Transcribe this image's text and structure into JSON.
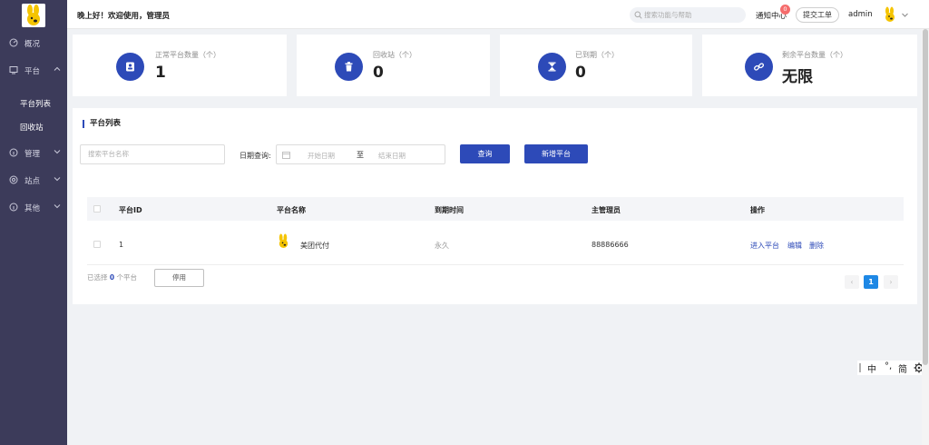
{
  "sidebar": {
    "items": [
      {
        "label": "概况",
        "icon": "gauge-icon"
      },
      {
        "label": "平台",
        "icon": "monitor-icon"
      },
      {
        "label": "管理",
        "icon": "info-icon"
      },
      {
        "label": "站点",
        "icon": "globe-icon"
      },
      {
        "label": "其他",
        "icon": "info-icon"
      }
    ],
    "subitems": [
      {
        "label": "平台列表"
      },
      {
        "label": "回收站"
      }
    ]
  },
  "header": {
    "greeting": "晚上好！欢迎使用，管理员",
    "search_placeholder": "搜索功能与帮助",
    "notify_label": "通知中心",
    "notify_count": "0",
    "ticket_label": "提交工单",
    "user": "admin"
  },
  "stats": [
    {
      "label": "正常平台数量（个）",
      "value": "1",
      "icon": "badge-icon"
    },
    {
      "label": "回收站（个）",
      "value": "0",
      "icon": "trash-icon"
    },
    {
      "label": "已到期（个）",
      "value": "0",
      "icon": "hourglass-icon"
    },
    {
      "label": "剩余平台数量（个）",
      "value": "无限",
      "icon": "link-icon"
    }
  ],
  "panel": {
    "title": "平台列表",
    "name_placeholder": "搜索平台名称",
    "date_label": "日期查询:",
    "date_start_placeholder": "开始日期",
    "date_sep": "至",
    "date_end_placeholder": "结束日期",
    "query_button": "查询",
    "add_button": "新增平台"
  },
  "table": {
    "columns": [
      "平台ID",
      "平台名称",
      "到期时间",
      "主管理员",
      "操作"
    ],
    "rows": [
      {
        "id": "1",
        "name": "美团代付",
        "expire": "永久",
        "admin": "88886666",
        "actions": [
          "进入平台",
          "编辑",
          "删除"
        ]
      }
    ]
  },
  "footer": {
    "selected_prefix": "已选择",
    "selected_count": "0",
    "selected_suffix": "个平台",
    "disable_button": "停用",
    "page_current": "1",
    "page_prev": "‹",
    "page_next": "›"
  },
  "ime": {
    "mode": "中",
    "punct": "°,",
    "charset": "简",
    "settings_icon": "gear-icon"
  },
  "colors": {
    "sidebar_bg": "#3c3b5a",
    "accent": "#2d4ab8",
    "page_active": "#1e88e5"
  }
}
